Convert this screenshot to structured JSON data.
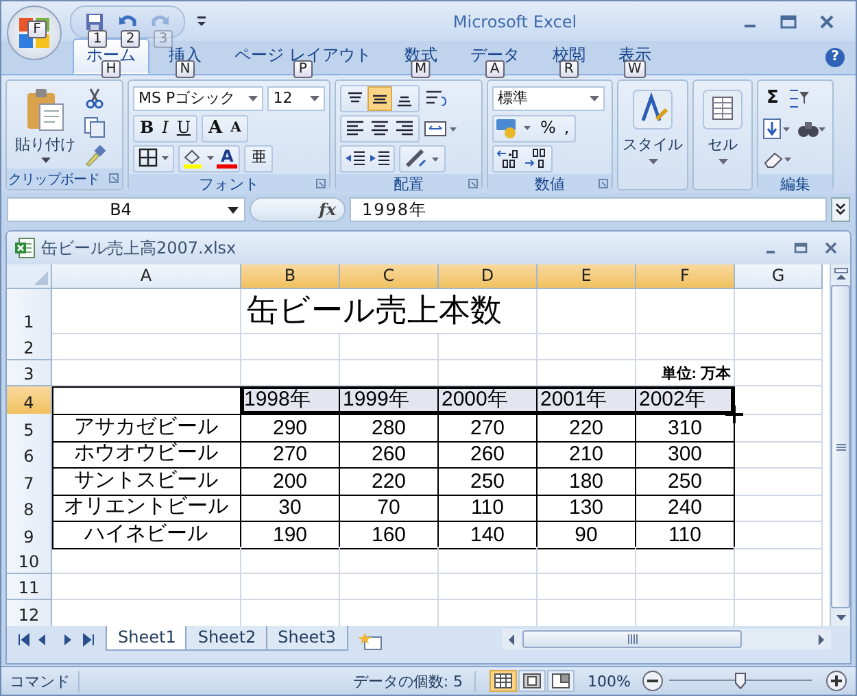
{
  "window": {
    "title": "Microsoft Excel",
    "help": "?"
  },
  "office_button": {
    "keytip": "F"
  },
  "quick_access": [
    {
      "kind": "save",
      "keytip": "1",
      "disabled": false
    },
    {
      "kind": "undo",
      "keytip": "2",
      "disabled": false
    },
    {
      "kind": "redo",
      "keytip": "3",
      "disabled": true
    }
  ],
  "tabs": [
    {
      "label": "ホーム",
      "keytip": "H",
      "selected": true
    },
    {
      "label": "挿入",
      "keytip": "N",
      "selected": false
    },
    {
      "label": "ページ レイアウト",
      "keytip": "P",
      "selected": false
    },
    {
      "label": "数式",
      "keytip": "M",
      "selected": false
    },
    {
      "label": "データ",
      "keytip": "A",
      "selected": false
    },
    {
      "label": "校閲",
      "keytip": "R",
      "selected": false
    },
    {
      "label": "表示",
      "keytip": "W",
      "selected": false
    }
  ],
  "ribbon": {
    "clipboard": {
      "paste": "貼り付け",
      "label": "クリップボード"
    },
    "font": {
      "name": "MS Pゴシック",
      "size": "12",
      "bold": "B",
      "italic": "I",
      "underline": "U",
      "grow": "A",
      "shrink": "A",
      "color_button": "A",
      "phonetic": "亜",
      "label": "フォント"
    },
    "alignment": {
      "vertical": [
        {
          "kind": "top",
          "selected": false
        },
        {
          "kind": "middle",
          "selected": true
        },
        {
          "kind": "bottom",
          "selected": false
        }
      ],
      "label": "配置"
    },
    "number": {
      "format": "標準",
      "percent": "%",
      "comma": ",",
      "label": "数値"
    },
    "styles": {
      "label": "スタイル"
    },
    "cells": {
      "label": "セル"
    },
    "editing": {
      "sum": "Σ",
      "label": "編集"
    }
  },
  "formula_bar": {
    "name_box": "B4",
    "fx": "fx",
    "value": "1998年"
  },
  "workbook": {
    "title": "缶ビール売上高2007.xlsx",
    "columns": [
      {
        "label": "A",
        "selected": false
      },
      {
        "label": "B",
        "selected": true
      },
      {
        "label": "C",
        "selected": true
      },
      {
        "label": "D",
        "selected": true
      },
      {
        "label": "E",
        "selected": true
      },
      {
        "label": "F",
        "selected": true
      },
      {
        "label": "G",
        "selected": false
      }
    ],
    "rows": [
      {
        "header": "1",
        "selected": false,
        "cells": [
          {},
          {
            "kind": "title",
            "text": "缶ビール売上本数"
          },
          {},
          {},
          {}
        ]
      },
      {
        "header": "2",
        "selected": false,
        "cells": [
          {},
          {},
          {},
          {},
          {},
          {},
          {}
        ]
      },
      {
        "header": "3",
        "selected": false,
        "cells": [
          {},
          {},
          {},
          {},
          {},
          {
            "kind": "unit",
            "text": "単位: 万本"
          },
          {}
        ]
      },
      {
        "header": "4",
        "selected": true,
        "cells": [
          {
            "boxed": true
          },
          {
            "kind": "year",
            "text": "1998年",
            "boxed": true
          },
          {
            "kind": "year",
            "text": "1999年",
            "boxed": true
          },
          {
            "kind": "year",
            "text": "2000年",
            "boxed": true
          },
          {
            "kind": "year",
            "text": "2001年",
            "boxed": true
          },
          {
            "kind": "year",
            "text": "2002年",
            "boxed": true
          },
          {}
        ]
      },
      {
        "header": "5",
        "selected": false,
        "cells": [
          {
            "kind": "name",
            "text": "アサカゼビール",
            "boxed": true
          },
          {
            "kind": "number",
            "text": "290",
            "boxed": true
          },
          {
            "kind": "number",
            "text": "280",
            "boxed": true
          },
          {
            "kind": "number",
            "text": "270",
            "boxed": true
          },
          {
            "kind": "number",
            "text": "220",
            "boxed": true
          },
          {
            "kind": "number",
            "text": "310",
            "boxed": true
          },
          {}
        ]
      },
      {
        "header": "6",
        "selected": false,
        "cells": [
          {
            "kind": "name",
            "text": "ホウオウビール",
            "boxed": true
          },
          {
            "kind": "number",
            "text": "270",
            "boxed": true
          },
          {
            "kind": "number",
            "text": "260",
            "boxed": true
          },
          {
            "kind": "number",
            "text": "260",
            "boxed": true
          },
          {
            "kind": "number",
            "text": "210",
            "boxed": true
          },
          {
            "kind": "number",
            "text": "300",
            "boxed": true
          },
          {}
        ]
      },
      {
        "header": "7",
        "selected": false,
        "cells": [
          {
            "kind": "name",
            "text": "サントスビール",
            "boxed": true
          },
          {
            "kind": "number",
            "text": "200",
            "boxed": true
          },
          {
            "kind": "number",
            "text": "220",
            "boxed": true
          },
          {
            "kind": "number",
            "text": "250",
            "boxed": true
          },
          {
            "kind": "number",
            "text": "180",
            "boxed": true
          },
          {
            "kind": "number",
            "text": "250",
            "boxed": true
          },
          {}
        ]
      },
      {
        "header": "8",
        "selected": false,
        "cells": [
          {
            "kind": "name",
            "text": "オリエントビール",
            "boxed": true
          },
          {
            "kind": "number",
            "text": "30",
            "boxed": true
          },
          {
            "kind": "number",
            "text": "70",
            "boxed": true
          },
          {
            "kind": "number",
            "text": "110",
            "boxed": true
          },
          {
            "kind": "number",
            "text": "130",
            "boxed": true
          },
          {
            "kind": "number",
            "text": "240",
            "boxed": true
          },
          {}
        ]
      },
      {
        "header": "9",
        "selected": false,
        "cells": [
          {
            "kind": "name",
            "text": "ハイネビール",
            "boxed": true
          },
          {
            "kind": "number",
            "text": "190",
            "boxed": true
          },
          {
            "kind": "number",
            "text": "160",
            "boxed": true
          },
          {
            "kind": "number",
            "text": "140",
            "boxed": true
          },
          {
            "kind": "number",
            "text": "90",
            "boxed": true
          },
          {
            "kind": "number",
            "text": "110",
            "boxed": true
          },
          {}
        ]
      },
      {
        "header": "10",
        "selected": false,
        "cells": [
          {},
          {},
          {},
          {},
          {},
          {},
          {}
        ]
      },
      {
        "header": "11",
        "selected": false,
        "cells": [
          {},
          {},
          {},
          {},
          {},
          {},
          {}
        ]
      },
      {
        "header": "12",
        "selected": false,
        "cells": [
          {},
          {},
          {},
          {},
          {},
          {},
          {}
        ]
      }
    ]
  },
  "sheet_tabs": [
    {
      "label": "Sheet1",
      "selected": true
    },
    {
      "label": "Sheet2",
      "selected": false
    },
    {
      "label": "Sheet3",
      "selected": false
    }
  ],
  "status_bar": {
    "mode": "コマンド",
    "count": "データの個数: 5",
    "views": [
      {
        "kind": "normal",
        "selected": true
      },
      {
        "kind": "page_layout",
        "selected": false
      },
      {
        "kind": "page_break",
        "selected": false
      }
    ],
    "zoom": "100%",
    "zoom_slider": {
      "level": 0.5
    }
  }
}
